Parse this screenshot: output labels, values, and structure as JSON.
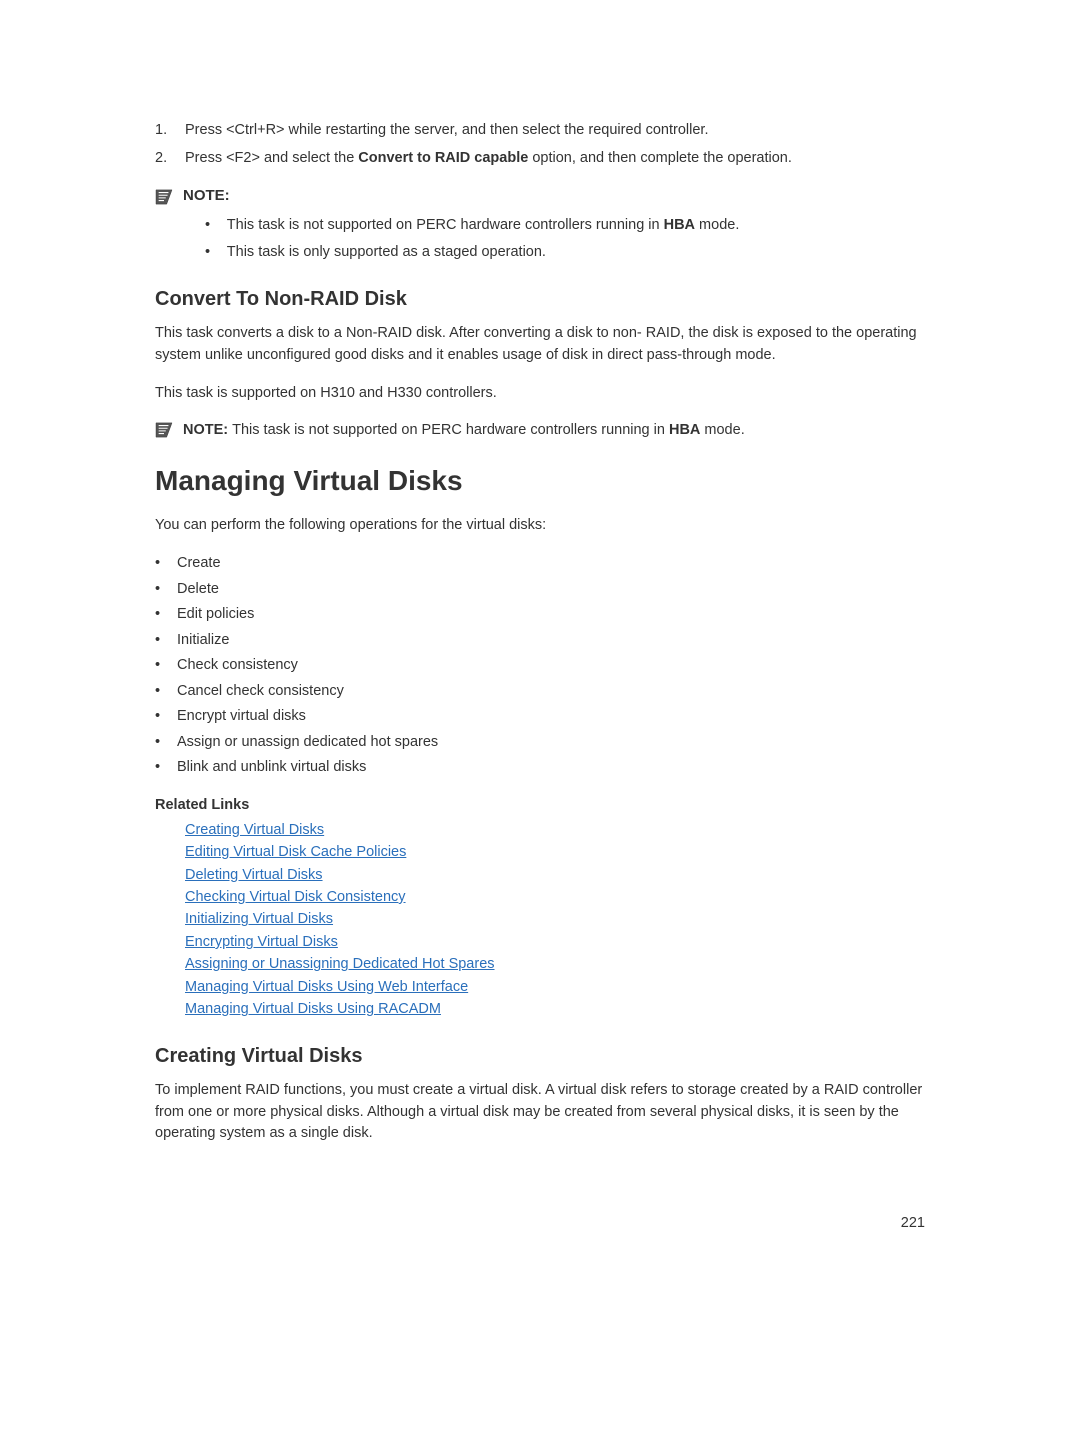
{
  "steps": [
    {
      "num": "1.",
      "text_before": "Press <Ctrl+R> while restarting the server, and then select the required controller."
    },
    {
      "num": "2.",
      "text_a": "Press <F2> and select the ",
      "bold": "Convert to RAID capable",
      "text_b": " option, and then complete the operation."
    }
  ],
  "note1": {
    "label": "NOTE:",
    "bullets": [
      {
        "a": "This task is not supported on PERC hardware controllers running in ",
        "bold": "HBA",
        "b": " mode."
      },
      {
        "a": "This task is only supported as a staged operation."
      }
    ]
  },
  "section1": {
    "heading": "Convert To Non-RAID Disk",
    "p1": "This task converts a disk to a Non-RAID disk. After converting a disk to non- RAID, the disk is exposed to the operating system unlike unconfigured good disks and it enables usage of disk in direct pass-through mode.",
    "p2": "This task is supported on H310 and H330 controllers."
  },
  "note2": {
    "label": "NOTE: ",
    "a": "This task is not supported on PERC hardware controllers running in ",
    "bold": "HBA",
    "b": " mode."
  },
  "section2": {
    "heading": "Managing Virtual Disks",
    "intro": "You can perform the following operations for the virtual disks:",
    "ops": [
      "Create",
      "Delete",
      "Edit policies",
      "Initialize",
      "Check consistency",
      "Cancel check consistency",
      "Encrypt virtual disks",
      "Assign or unassign dedicated hot spares",
      "Blink and unblink virtual disks"
    ]
  },
  "related": {
    "heading": "Related Links",
    "links": [
      "Creating Virtual Disks",
      "Editing Virtual Disk Cache Policies",
      "Deleting Virtual Disks",
      "Checking Virtual Disk Consistency",
      "Initializing Virtual Disks",
      "Encrypting Virtual Disks",
      "Assigning or Unassigning Dedicated Hot Spares",
      "Managing Virtual Disks Using Web Interface",
      "Managing Virtual Disks Using RACADM"
    ]
  },
  "section3": {
    "heading": "Creating Virtual Disks",
    "p1": "To implement RAID functions, you must create a virtual disk. A virtual disk refers to storage created by a RAID controller from one or more physical disks. Although a virtual disk may be created from several physical disks, it is seen by the operating system as a single disk."
  },
  "pageNumber": "221"
}
